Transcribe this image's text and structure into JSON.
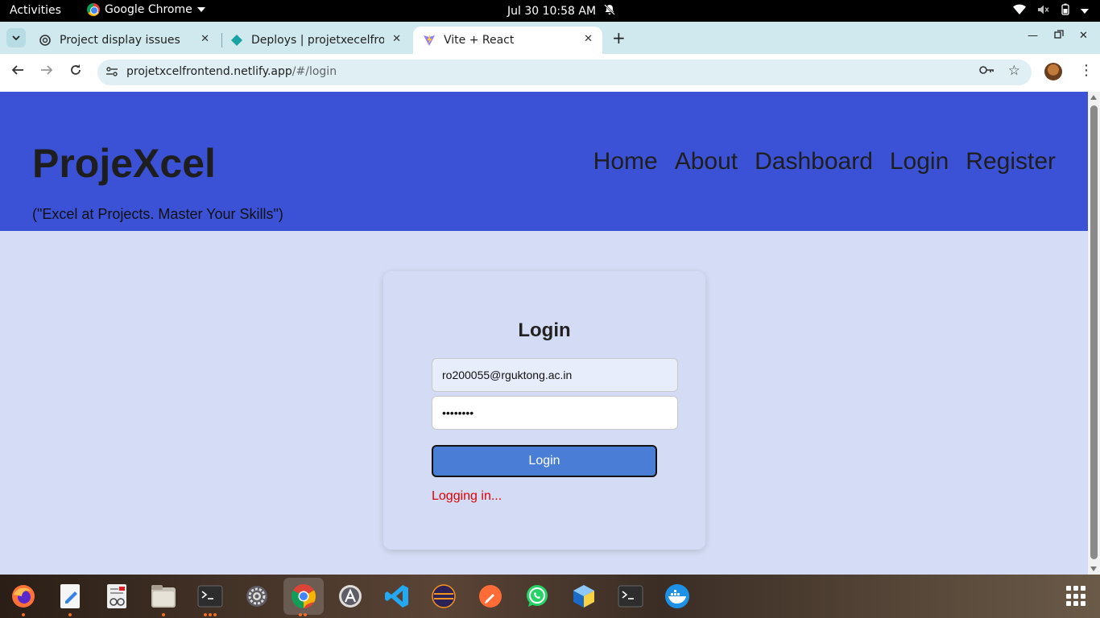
{
  "system_bar": {
    "activities": "Activities",
    "app_name": "Google Chrome",
    "datetime": "Jul 30  10:58 AM"
  },
  "tabs": [
    {
      "title": "Project display issues",
      "icon": "openai-icon",
      "active": false
    },
    {
      "title": "Deploys | projetxecelfrontend",
      "icon": "netlify-icon",
      "active": false
    },
    {
      "title": "Vite + React",
      "icon": "vite-icon",
      "active": true
    }
  ],
  "address_bar": {
    "host": "projetxcelfrontend.netlify.app",
    "path": "/#/login"
  },
  "site": {
    "brand": "ProjeXcel",
    "tagline": "(\"Excel at Projects. Master Your Skills\")",
    "nav": [
      "Home",
      "About",
      "Dashboard",
      "Login",
      "Register"
    ],
    "header_color": "#3c52d6",
    "page_bg": "#d4ddf5"
  },
  "login_form": {
    "title": "Login",
    "email_value": "ro200055@rguktong.ac.in",
    "password_value": "••••••••",
    "submit_label": "Login",
    "status": "Logging in...",
    "status_color": "#e00000",
    "button_color": "#4a7ed6"
  },
  "dock": {
    "apps": [
      "firefox-icon",
      "text-editor-icon",
      "document-viewer-icon",
      "files-icon",
      "terminal-icon",
      "settings-icon",
      "chrome-icon",
      "software-center-icon",
      "vscode-icon",
      "eclipse-icon",
      "postman-icon",
      "whatsapp-icon",
      "netbeans-icon",
      "terminal-icon",
      "docker-icon"
    ]
  }
}
